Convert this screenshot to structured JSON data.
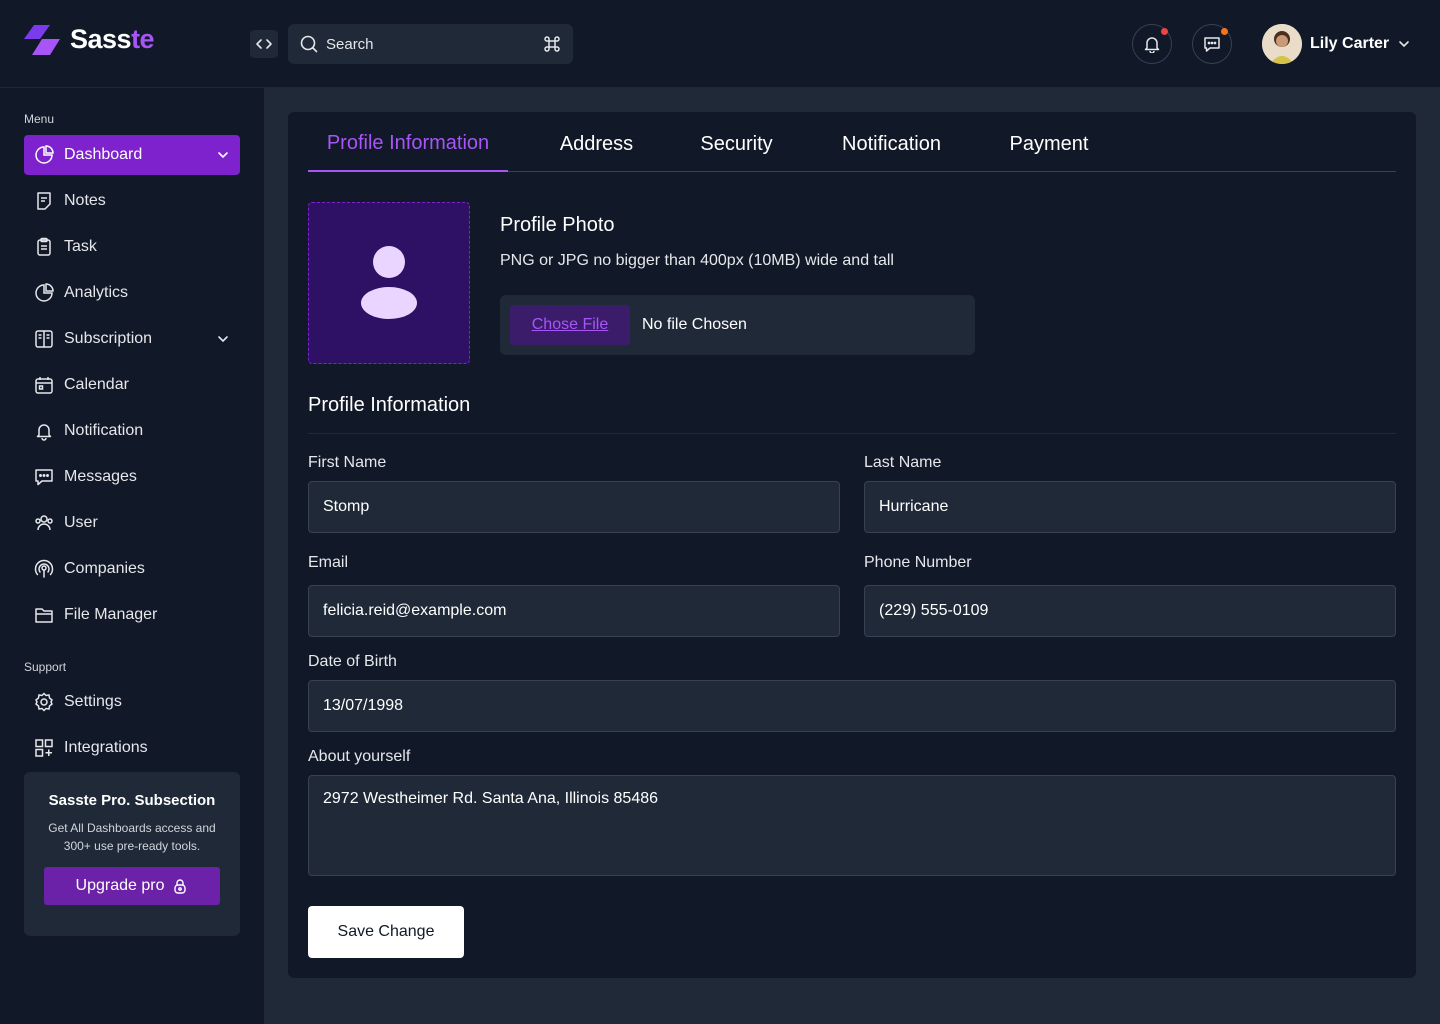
{
  "brand": {
    "name_main": "Sass",
    "name_accent": "te"
  },
  "header": {
    "search_placeholder": "Search",
    "user_name": "Lily Carter",
    "notification_dot_color": "#ef4444",
    "message_dot_color": "#f97316"
  },
  "sidebar": {
    "menu_label": "Menu",
    "items": [
      {
        "label": "Dashboard",
        "icon": "pie-chart-icon",
        "active": true,
        "has_chevron": true
      },
      {
        "label": "Notes",
        "icon": "note-icon"
      },
      {
        "label": "Task",
        "icon": "clipboard-icon"
      },
      {
        "label": "Analytics",
        "icon": "pie-chart-icon"
      },
      {
        "label": "Subscription",
        "icon": "layout-icon",
        "has_chevron": true
      },
      {
        "label": "Calendar",
        "icon": "calendar-icon"
      },
      {
        "label": "Notification",
        "icon": "bell-icon"
      },
      {
        "label": "Messages",
        "icon": "message-icon"
      },
      {
        "label": "User",
        "icon": "users-icon"
      },
      {
        "label": "Companies",
        "icon": "broadcast-icon"
      },
      {
        "label": "File Manager",
        "icon": "folder-icon"
      }
    ],
    "support_label": "Support",
    "support_items": [
      {
        "label": "Settings",
        "icon": "gear-icon"
      },
      {
        "label": "Integrations",
        "icon": "grid-plus-icon"
      }
    ],
    "promo": {
      "title": "Sasste Pro. Subsection",
      "description": "Get All Dashboards access and 300+ use pre-ready tools.",
      "button_label": "Upgrade pro"
    }
  },
  "tabs": [
    {
      "label": "Profile Information",
      "active": true
    },
    {
      "label": "Address"
    },
    {
      "label": "Security"
    },
    {
      "label": "Notification"
    },
    {
      "label": "Payment"
    }
  ],
  "profile_photo": {
    "title": "Profile Photo",
    "hint": "PNG or JPG no bigger than 400px (10MB) wide and tall",
    "choose_label": "Chose File",
    "file_status": "No file Chosen"
  },
  "form": {
    "section_title": "Profile Information",
    "first_name": {
      "label": "First Name",
      "value": "Stomp"
    },
    "last_name": {
      "label": "Last Name",
      "value": "Hurricane"
    },
    "email": {
      "label": "Email",
      "value": "felicia.reid@example.com"
    },
    "phone": {
      "label": "Phone Number",
      "value": "(229) 555-0109"
    },
    "dob": {
      "label": "Date of Birth",
      "value": "13/07/1998"
    },
    "about": {
      "label": "About yourself",
      "value": "2972 Westheimer Rd. Santa Ana, Illinois 85486"
    },
    "save_label": "Save Change"
  },
  "colors": {
    "accent": "#a855f7",
    "active_bg": "#7e22ce",
    "background": "#111827",
    "surface": "#1f2937"
  }
}
